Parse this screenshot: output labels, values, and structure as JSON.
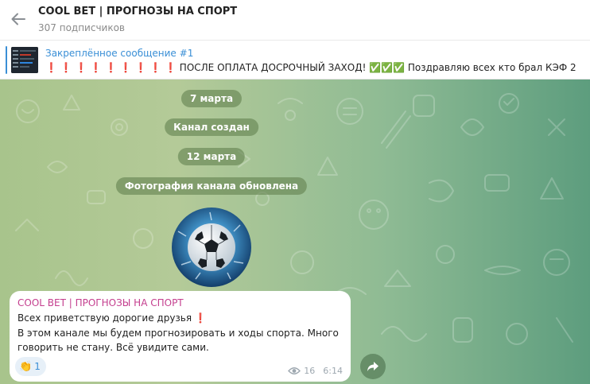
{
  "header": {
    "title": "COOL BET | ПРОГНОЗЫ НА СПОРТ",
    "subscribers": "307 подписчиков",
    "back_icon": "arrow-left-icon"
  },
  "pinned": {
    "title": "Закреплённое сообщение #1",
    "text": "❗ ❗ ❗ ❗ ❗ ❗ ❗ ❗ ❗   ПОСЛЕ ОПЛАТА ДОСРОЧНЫЙ ЗАХОД! ✅✅✅  Поздравляю всех кто брал   КЭФ 2"
  },
  "service": {
    "date1": "7 марта",
    "created": "Канал создан",
    "date2": "12 марта",
    "photo_updated": "Фотография канала обновлена"
  },
  "message": {
    "author": "COOL BET | ПРОГНОЗЫ НА СПОРТ",
    "line1": "Всех приветствую дорогие друзья ❗",
    "line2": "В этом канале мы будем прогнозировать и ходы спорта. Много",
    "line3": "говорить не стану. Всё увидите сами.",
    "reaction_emoji": "👏",
    "reaction_count": "1",
    "views": "16",
    "time": "6:14"
  },
  "colors": {
    "accent": "#3a8fd6",
    "author": "#c43e8e",
    "service_pill": "#64824f"
  }
}
